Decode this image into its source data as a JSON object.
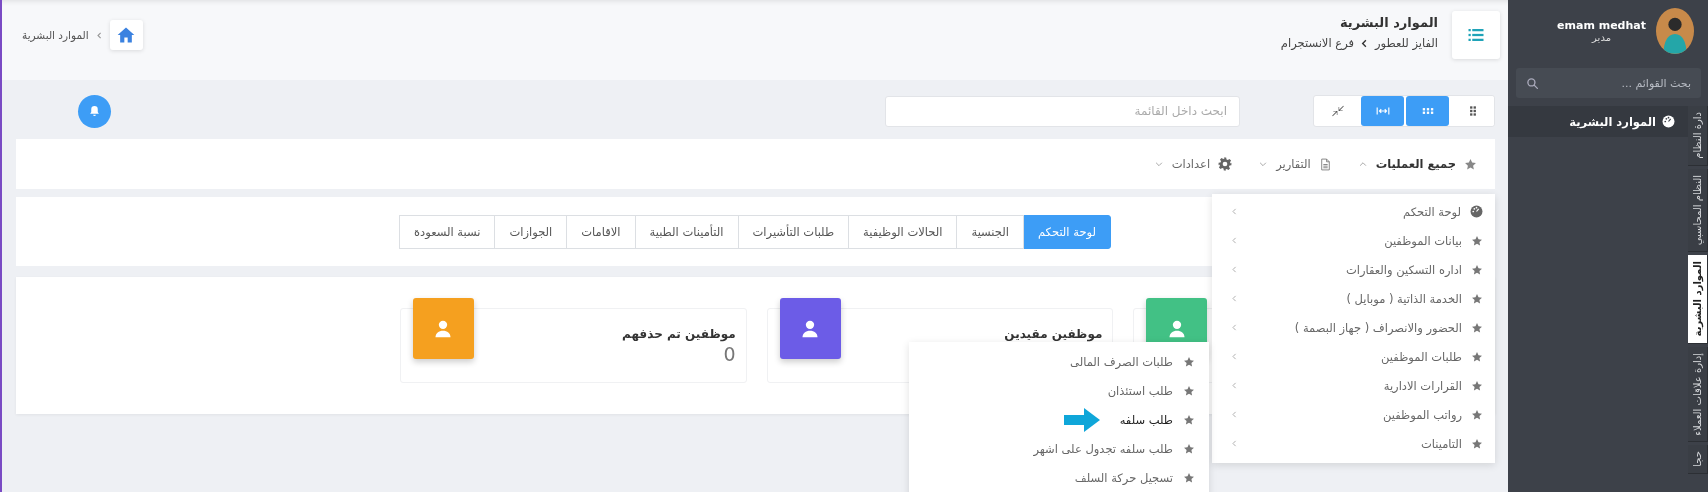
{
  "header": {
    "title": "الموارد البشرية",
    "breadcrumb": [
      "الفايز للعطور",
      "فرع الانستجرام"
    ]
  },
  "home_breadcrumb": {
    "label": "الموارد البشرية"
  },
  "view_buttons": [
    {
      "kind": "grid",
      "selected": false
    },
    {
      "kind": "dots",
      "selected": true
    },
    {
      "kind": "expand",
      "selected": true
    },
    {
      "kind": "compress",
      "selected": false
    }
  ],
  "search": {
    "placeholder": "ابحث داخل القائمة"
  },
  "nav": [
    {
      "kind": "star",
      "label": "جميع العمليات",
      "expanded": true
    },
    {
      "kind": "report",
      "label": "التقارير",
      "expanded": false
    },
    {
      "kind": "settings",
      "label": "اعدادات",
      "expanded": false
    }
  ],
  "tabs": [
    {
      "label": "لوحة التحكم",
      "selected": true
    },
    {
      "label": "الجنسية",
      "selected": false
    },
    {
      "label": "الحالات الوظيفية",
      "selected": false
    },
    {
      "label": "طلبات التأشيرات",
      "selected": false
    },
    {
      "label": "التأمينات الطبية",
      "selected": false
    },
    {
      "label": "الاقامات",
      "selected": false
    },
    {
      "label": "الجوازات",
      "selected": false
    },
    {
      "label": "نسبة السعودة",
      "selected": false
    }
  ],
  "cards": [
    {
      "color": "#42c185"
    },
    {
      "title": "موظفين مقيدين",
      "color": "#6c5ce7"
    },
    {
      "title": "موظفين تم حذفهم",
      "value": "0",
      "color": "#f5a01f"
    }
  ],
  "menu": {
    "items": [
      {
        "kind": "dashboard",
        "label": "لوحة التحكم"
      },
      {
        "kind": "star",
        "label": "بيانات الموظفين"
      },
      {
        "kind": "star",
        "label": "اداره التسكين والعقارات"
      },
      {
        "kind": "star",
        "label": "الخدمة الذاتية ( موبايل )"
      },
      {
        "kind": "star",
        "label": "الحضور والانصراف ( جهاز البصمة )"
      },
      {
        "kind": "star",
        "label": "طلبات الموظفين"
      },
      {
        "kind": "star",
        "label": "القرارات الادارية"
      },
      {
        "kind": "star",
        "label": "رواتب الموظفين"
      },
      {
        "kind": "star",
        "label": "التامينات"
      }
    ]
  },
  "submenu": {
    "items": [
      {
        "label": "طلبات الصرف المالى",
        "selected": false
      },
      {
        "label": "طلب استئذان",
        "selected": false
      },
      {
        "label": "طلب سلفه",
        "selected": true
      },
      {
        "label": "طلب سلفه تجدول على اشهر",
        "selected": false
      },
      {
        "label": "تسجيل حركة السلف",
        "selected": false
      }
    ]
  },
  "sidebar": {
    "user": {
      "name": "emam medhat",
      "role": "مدير"
    },
    "search": {
      "placeholder": "بحث القوائم ..."
    },
    "menu_item": "الموارد البشرية",
    "vertical_tabs": [
      {
        "label": "دارة النظام",
        "selected": false
      },
      {
        "label": "النظام المحاسبي",
        "selected": false
      },
      {
        "label": "الموارد البشرية",
        "selected": true
      },
      {
        "label": "إدارة علاقات العملاء",
        "selected": false
      },
      {
        "label": "حجا",
        "selected": false
      }
    ]
  }
}
